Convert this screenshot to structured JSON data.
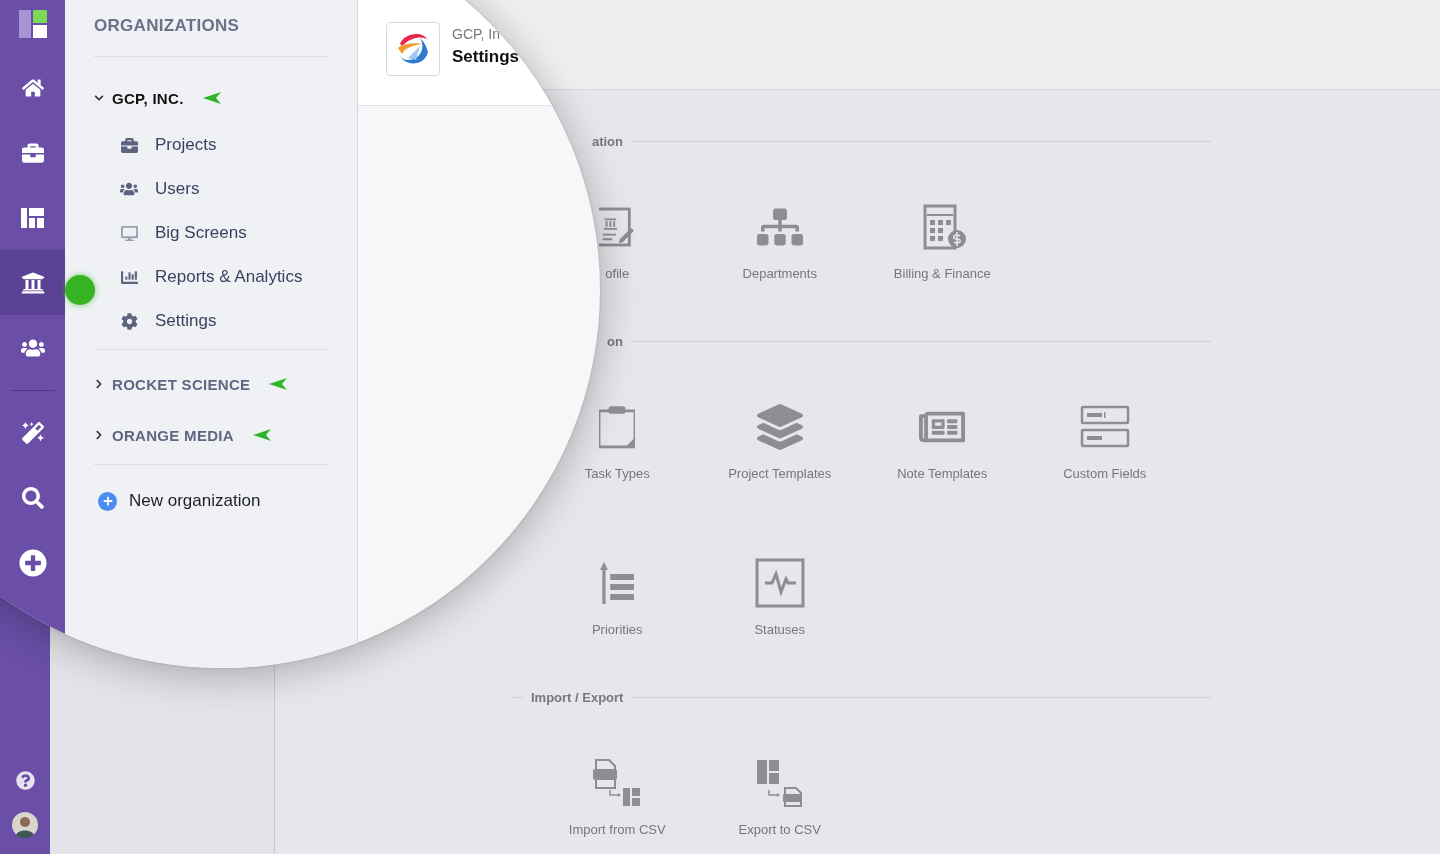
{
  "rail": {
    "items": [
      {
        "selected": false
      },
      {
        "selected": false
      },
      {
        "selected": false
      },
      {
        "selected": true
      },
      {
        "selected": false
      },
      {
        "selected": false
      },
      {
        "selected": false
      },
      {
        "selected": false
      }
    ]
  },
  "organizations": {
    "heading": "ORGANIZATIONS",
    "orgs": [
      {
        "name": "GCP, INC.",
        "expanded": true,
        "children": [
          {
            "label": "Projects"
          },
          {
            "label": "Users"
          },
          {
            "label": "Big Screens"
          },
          {
            "label": "Reports & Analytics"
          },
          {
            "label": "Settings"
          }
        ]
      },
      {
        "name": "ROCKET SCIENCE",
        "expanded": false
      },
      {
        "name": "ORANGE MEDIA",
        "expanded": false
      }
    ],
    "new_button": "New organization"
  },
  "header": {
    "org": "GCP, In",
    "title": "Settings"
  },
  "sections": [
    {
      "title": "ation",
      "items": [
        {
          "label": "ofile"
        },
        {
          "label": "Departments"
        },
        {
          "label": "Billing & Finance"
        }
      ]
    },
    {
      "title": "on",
      "items": [
        {
          "label": "Task Types"
        },
        {
          "label": "Project Templates"
        },
        {
          "label": "Note Templates"
        },
        {
          "label": "Custom Fields"
        },
        {
          "label": "Priorities"
        },
        {
          "label": "Statuses"
        }
      ]
    },
    {
      "title": "Import / Export",
      "items": [
        {
          "label": "Import from CSV"
        },
        {
          "label": "Export to CSV"
        }
      ]
    }
  ]
}
